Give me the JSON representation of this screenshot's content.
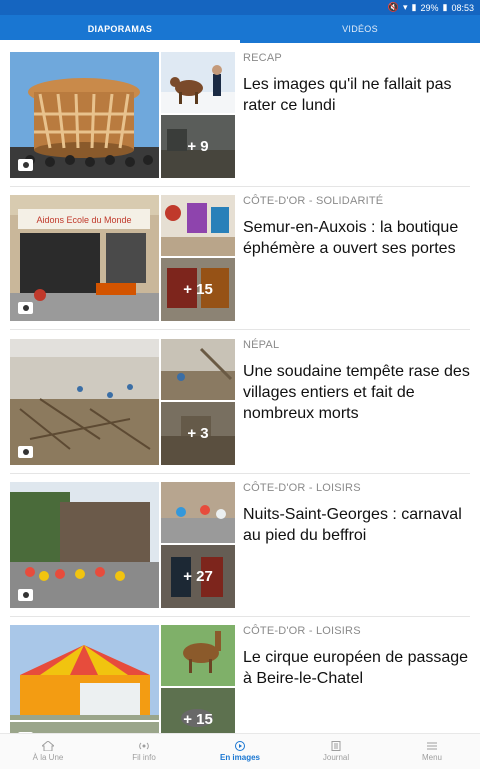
{
  "status": {
    "battery": "29%",
    "time": "08:53"
  },
  "tabs": [
    {
      "label": "DIAPORAMAS"
    },
    {
      "label": "VIDÉOS"
    }
  ],
  "articles": [
    {
      "category": "RECAP",
      "title": "Les images qu'il ne fallait pas rater ce lundi",
      "count": "+ 9"
    },
    {
      "category": "CÔTE-D'OR - SOLIDARITÉ",
      "title": "Semur-en-Auxois : la boutique éphémère a ouvert ses portes",
      "count": "+ 15",
      "shop_sign": "Aidons Ecole du Monde"
    },
    {
      "category": "NÉPAL",
      "title": "Une soudaine tempête rase des villages entiers et fait de nombreux morts",
      "count": "+ 3"
    },
    {
      "category": "CÔTE-D'OR - LOISIRS",
      "title": "Nuits-Saint-Georges : carnaval au pied du beffroi",
      "count": "+ 27"
    },
    {
      "category": "CÔTE-D'OR - LOISIRS",
      "title": "Le cirque européen de passage à Beire-le-Chatel",
      "count": "+ 15"
    }
  ],
  "bottom_nav": [
    {
      "label": "À la Une",
      "icon": "home-icon"
    },
    {
      "label": "Fil info",
      "icon": "radio-icon"
    },
    {
      "label": "En images",
      "icon": "play-icon"
    },
    {
      "label": "Journal",
      "icon": "newspaper-icon"
    },
    {
      "label": "Menu",
      "icon": "menu-icon"
    }
  ],
  "colors": {
    "header": "#1976d2",
    "statusbar": "#1565c0",
    "active_nav": "#1976d2"
  }
}
